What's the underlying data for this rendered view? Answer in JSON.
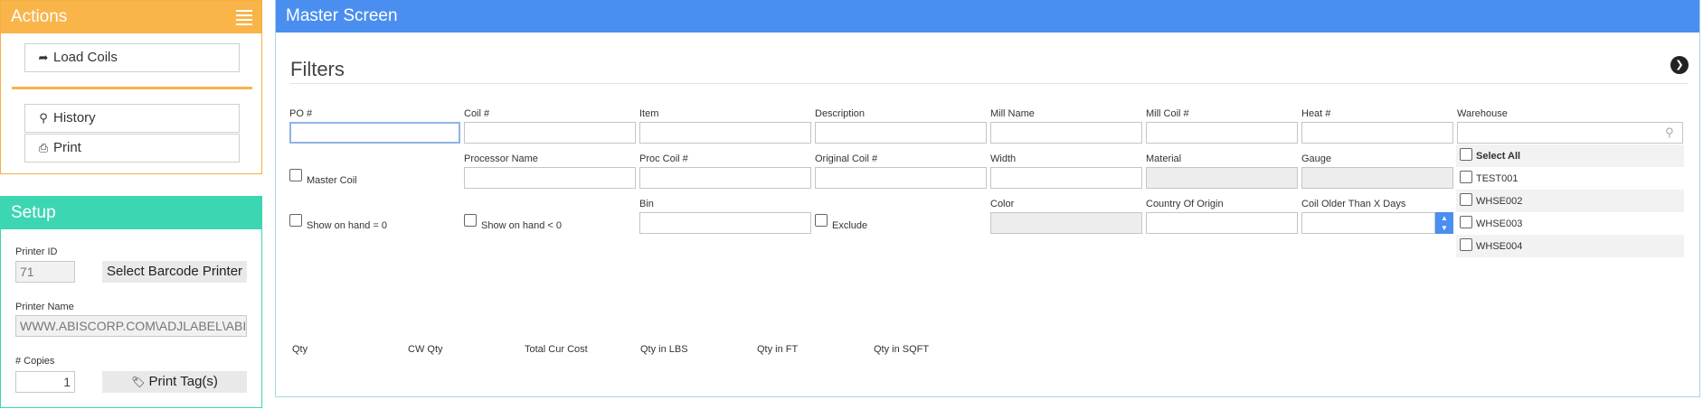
{
  "actions": {
    "title": "Actions",
    "load_coils": "Load Coils",
    "history": "History",
    "print": "Print"
  },
  "setup": {
    "title": "Setup",
    "printer_id_label": "Printer ID",
    "printer_id_value": "71",
    "select_printer": "Select Barcode Printer",
    "printer_name_label": "Printer Name",
    "printer_name_value": "WWW.ABISCORP.COM\\ADJLABEL\\ABIS",
    "copies_label": "# Copies",
    "copies_value": "1",
    "print_tags": "Print Tag(s)"
  },
  "master": {
    "title": "Master Screen",
    "filters_title": "Filters",
    "fields": {
      "po": "PO #",
      "coil": "Coil #",
      "item": "Item",
      "description": "Description",
      "mill_name": "Mill Name",
      "mill_coil": "Mill Coil #",
      "heat": "Heat #",
      "warehouse": "Warehouse",
      "master_coil": "Master Coil",
      "processor_name": "Processor Name",
      "proc_coil": "Proc Coil #",
      "original_coil": "Original Coil #",
      "width": "Width",
      "material": "Material",
      "gauge": "Gauge",
      "show_on_hand_zero": "Show on hand = 0",
      "show_on_hand_neg": "Show on hand < 0",
      "bin": "Bin",
      "exclude": "Exclude",
      "color": "Color",
      "country_of_origin": "Country Of Origin",
      "coil_older_than": "Coil Older Than X Days"
    },
    "warehouses": {
      "select_all": "Select All",
      "items": [
        "TEST001",
        "WHSE002",
        "WHSE003",
        "WHSE004"
      ]
    },
    "summary": {
      "qty": "Qty",
      "cw_qty": "CW Qty",
      "total_cur_cost": "Total Cur Cost",
      "qty_lbs": "Qty in LBS",
      "qty_ft": "Qty in FT",
      "qty_sqft": "Qty in SQFT"
    }
  },
  "colors": {
    "actions_accent": "#f9b44a",
    "setup_accent": "#3dd6b3",
    "master_accent": "#4a8ff0"
  }
}
